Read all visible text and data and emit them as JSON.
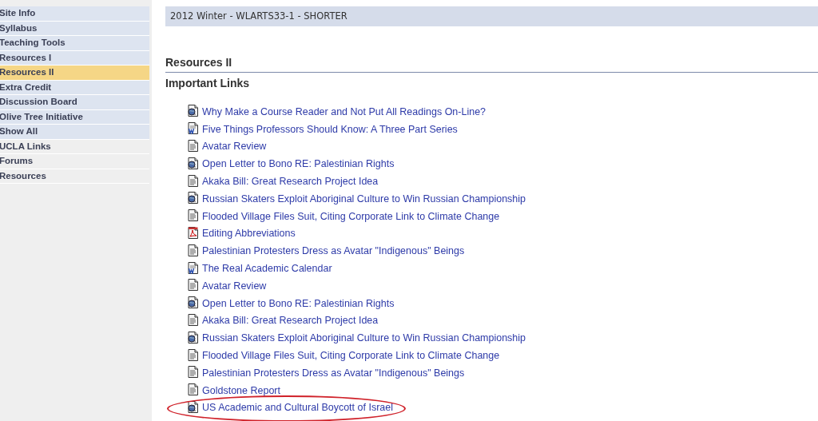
{
  "sidebar": {
    "items": [
      {
        "label": "Site Info",
        "kind": "course",
        "selected": false
      },
      {
        "label": "Syllabus",
        "kind": "course",
        "selected": false
      },
      {
        "label": "Teaching Tools",
        "kind": "course",
        "selected": false
      },
      {
        "label": "Resources I",
        "kind": "course",
        "selected": false
      },
      {
        "label": "Resources II",
        "kind": "course",
        "selected": true
      },
      {
        "label": "Extra Credit",
        "kind": "course",
        "selected": false
      },
      {
        "label": "Discussion Board",
        "kind": "course",
        "selected": false
      },
      {
        "label": "Olive Tree Initiative",
        "kind": "course",
        "selected": false
      },
      {
        "label": "Show All",
        "kind": "course",
        "selected": false
      },
      {
        "label": "UCLA Links",
        "kind": "tool",
        "selected": false
      },
      {
        "label": "Forums",
        "kind": "tool",
        "selected": false
      },
      {
        "label": "Resources",
        "kind": "tool",
        "selected": false
      }
    ]
  },
  "header": {
    "title": "2012 Winter - WLARTS33-1 - SHORTER"
  },
  "content": {
    "heading": "Resources II",
    "subheading": "Important Links",
    "links": [
      {
        "label": "Why Make a Course Reader and Not Put All Readings On-Line?",
        "kind": "web",
        "circled": false
      },
      {
        "label": "Five Things Professors Should Know: A Three Part Series",
        "kind": "word",
        "circled": false
      },
      {
        "label": "Avatar Review",
        "kind": "doc",
        "circled": false
      },
      {
        "label": "Open Letter to Bono RE: Palestinian Rights",
        "kind": "web",
        "circled": false
      },
      {
        "label": "Akaka Bill: Great Research Project Idea",
        "kind": "doc",
        "circled": false
      },
      {
        "label": "Russian Skaters Exploit Aboriginal Culture to Win Russian Championship",
        "kind": "web",
        "circled": false
      },
      {
        "label": "Flooded Village Files Suit, Citing Corporate Link to Climate Change",
        "kind": "doc",
        "circled": false
      },
      {
        "label": "Editing Abbreviations",
        "kind": "pdf",
        "circled": false
      },
      {
        "label": "Palestinian Protesters Dress as Avatar \"Indigenous\" Beings",
        "kind": "doc",
        "circled": false
      },
      {
        "label": "The Real Academic Calendar",
        "kind": "word",
        "circled": false
      },
      {
        "label": "Avatar Review",
        "kind": "doc",
        "circled": false
      },
      {
        "label": "Open Letter to Bono RE: Palestinian Rights",
        "kind": "web",
        "circled": false
      },
      {
        "label": "Akaka Bill: Great Research Project Idea",
        "kind": "doc",
        "circled": false
      },
      {
        "label": "Russian Skaters Exploit Aboriginal Culture to Win Russian Championship",
        "kind": "web",
        "circled": false
      },
      {
        "label": "Flooded Village Files Suit, Citing Corporate Link to Climate Change",
        "kind": "doc",
        "circled": false
      },
      {
        "label": "Palestinian Protesters Dress as Avatar \"Indigenous\" Beings",
        "kind": "doc",
        "circled": false
      },
      {
        "label": "Goldstone Report",
        "kind": "doc",
        "circled": false
      },
      {
        "label": "US Academic and Cultural Boycott of Israel",
        "kind": "web",
        "circled": true
      }
    ]
  }
}
